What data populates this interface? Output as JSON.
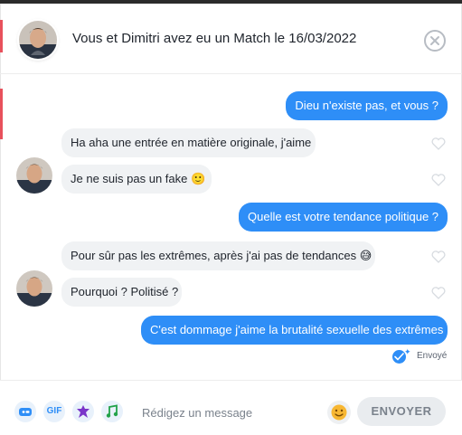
{
  "header": {
    "avatar_icon": "person-avatar",
    "title": "Vous et Dimitri avez eu un Match le 16/03/2022",
    "close_icon": "close-icon"
  },
  "messages": [
    {
      "side": "me",
      "text": "Dieu n'existe pas, et vous ?"
    },
    {
      "side": "them",
      "text": "Ha aha une entrée en matière originale, j'aime",
      "liked": false
    },
    {
      "side": "them",
      "text": "Je ne suis pas un fake 🙂",
      "liked": false
    },
    {
      "side": "me",
      "text": "Quelle est votre tendance politique ?"
    },
    {
      "side": "them",
      "text": "Pour sûr pas les extrêmes, après j'ai pas de tendances 😅",
      "liked": false
    },
    {
      "side": "them",
      "text": "Pourquoi ? Politisé ?",
      "liked": false
    },
    {
      "side": "me",
      "text": "C'est dommage j'aime la brutalité sexuelle des extrêmes"
    }
  ],
  "status": {
    "label": "Envoyé",
    "icon": "read-check-icon"
  },
  "composer": {
    "tools": [
      {
        "name": "sticker-icon"
      },
      {
        "name": "gif-button",
        "label": "GIF"
      },
      {
        "name": "bitmoji-icon"
      },
      {
        "name": "music-note-icon"
      }
    ],
    "placeholder": "Rédigez un message",
    "emoji_icon": "smiley-icon",
    "send_label": "ENVOYER"
  },
  "colors": {
    "accent_blue": "#2e8ef7",
    "accent_red": "#e8515c",
    "bubble_gray": "#f0f2f4",
    "text_dark": "#21262e",
    "muted": "#7a828c"
  }
}
